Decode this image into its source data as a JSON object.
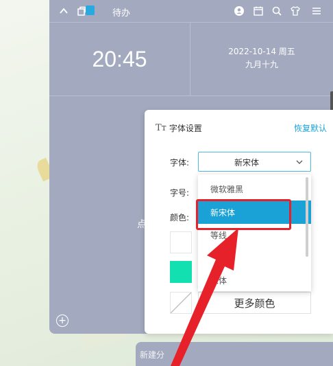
{
  "topbar": {
    "todo_label": "待办",
    "icons": [
      "chevron-up-icon",
      "window-icon",
      "todo-check-icon",
      "user-icon",
      "calendar-icon",
      "search-icon",
      "shirt-icon",
      "menu-icon"
    ]
  },
  "clock": {
    "time": "20:45"
  },
  "date": {
    "line1": "2022-10-14  周五",
    "line2": "九月十九"
  },
  "background_hint": "点",
  "panel": {
    "title": "字体设置",
    "reset_label": "恢复默认",
    "font_label": "字体:",
    "size_label": "字号:",
    "color_label": "颜色:",
    "font_value": "新宋体",
    "more_colors": "更多颜色"
  },
  "dropdown": {
    "options": [
      "微软雅黑",
      "新宋体",
      "等线",
      "宋体"
    ],
    "selected": "新宋体"
  },
  "newbar": {
    "text": "新建分"
  },
  "colors": {
    "accent": "#1aa2d6",
    "highlight": "#e62129",
    "teal_swatch": "#12e0b0",
    "widget_bg": "#a3aabf"
  }
}
